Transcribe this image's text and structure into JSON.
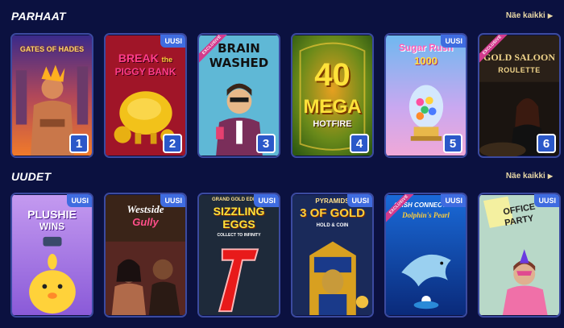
{
  "sections": {
    "top": {
      "title": "PARHAAT",
      "see_all_label": "Näe kaikki",
      "games": [
        {
          "title": "GATES OF HADES",
          "rank": "1"
        },
        {
          "title_line1": "BREAK",
          "title_small": "the",
          "title_line2": "PIGGY BANK",
          "badge": "UUSI",
          "rank": "2"
        },
        {
          "title_line1": "BRAIN",
          "title_line2": "WASHED",
          "exclusive": "EXCLUSIVE",
          "rank": "3"
        },
        {
          "title_line1": "40",
          "title_line2": "MEGA",
          "title_line3": "HOTFIRE",
          "rank": "4"
        },
        {
          "title_line1": "Sugar Rush",
          "title_line2": "1000",
          "badge": "UUSI",
          "rank": "5"
        },
        {
          "title_line1": "GOLD SALOON",
          "title_line2": "ROULETTE",
          "exclusive": "EXCLUSIVE",
          "rank": "6"
        }
      ]
    },
    "new": {
      "title": "UUDET",
      "see_all_label": "Näe kaikki",
      "games": [
        {
          "title_line1": "PLUSHIE",
          "title_line2": "WINS",
          "badge": "UUSI"
        },
        {
          "title_line1": "Westside",
          "title_line2": "Gully",
          "badge": "UUSI"
        },
        {
          "title_top": "GRAND GOLD EDITION",
          "title_line1": "SIZZLING",
          "title_line2": "EGGS",
          "title_small": "COLLECT TO INFINITY",
          "badge": "UUSI"
        },
        {
          "title_top": "PYRAMIDS",
          "title_line1": "3 OF GOLD",
          "title_small": "HOLD & COIN",
          "badge": "UUSI"
        },
        {
          "title_line1": "CASH CONNECTION",
          "title_line2": "Dolphin's Pearl",
          "exclusive": "EXCLUSIVE",
          "badge": "UUSI"
        },
        {
          "title_line1": "OFFICE",
          "title_line2": "PARTY",
          "badge": "UUSI"
        }
      ]
    }
  },
  "colors": {
    "page_background": "#0b1140",
    "card_border": "#3b4aa0",
    "rank_badge": "#2b58c9",
    "new_badge": "#3f6ce0",
    "exclusive_ribbon": "#d23a8c",
    "see_all_text": "#e9d8a6"
  },
  "icons": {
    "see_all_arrow": "triangle-right-icon"
  }
}
